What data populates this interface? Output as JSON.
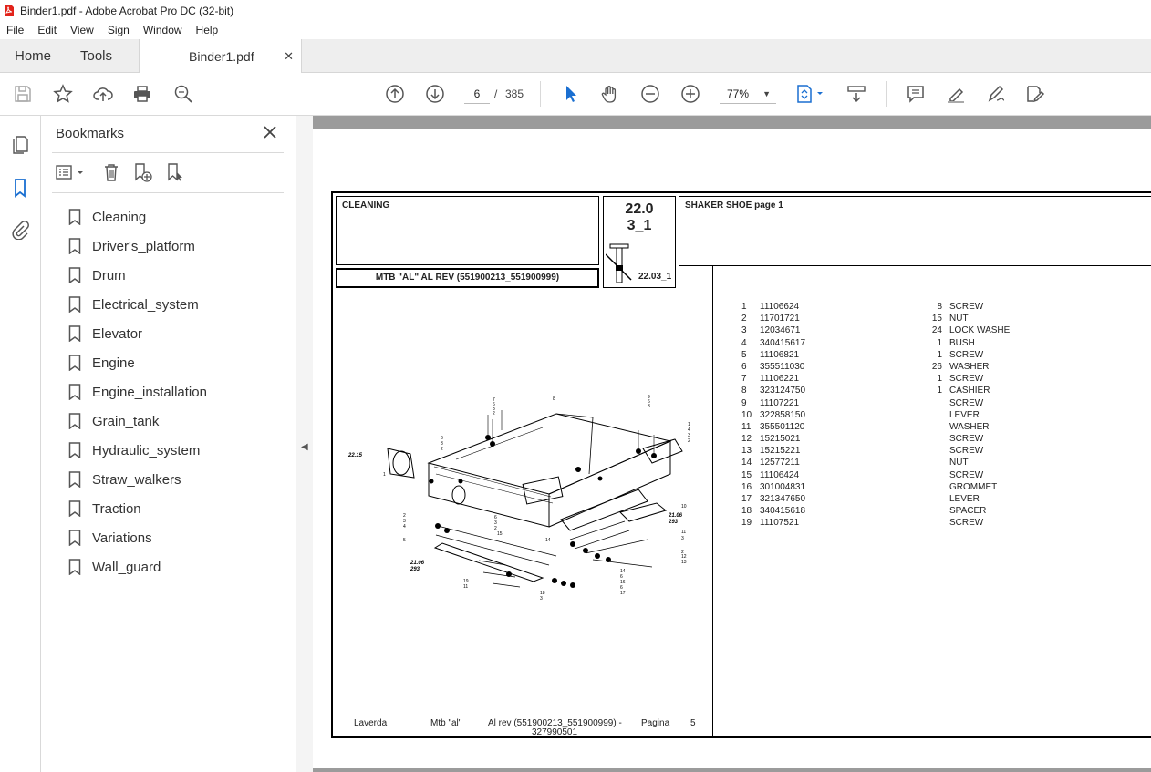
{
  "window": {
    "title": "Binder1.pdf - Adobe Acrobat Pro DC (32-bit)"
  },
  "menu": [
    "File",
    "Edit",
    "View",
    "Sign",
    "Window",
    "Help"
  ],
  "tabs": {
    "home": "Home",
    "tools": "Tools",
    "document": "Binder1.pdf"
  },
  "toolbar": {
    "current_page": "6",
    "page_separator": "/",
    "total_pages": "385",
    "zoom": "77%"
  },
  "bookmarks": {
    "title": "Bookmarks",
    "items": [
      "Cleaning",
      "Driver's_platform",
      "Drum",
      "Electrical_system",
      "Elevator",
      "Engine",
      "Engine_installation",
      "Grain_tank",
      "Hydraulic_system",
      "Straw_walkers",
      "Traction",
      "Variations",
      "Wall_guard"
    ]
  },
  "document": {
    "group_title": "CLEANING",
    "code_line1": "22.0",
    "code_line2": "3_1",
    "code_small": "22.03_1",
    "model": "MTB \"AL\" AL REV (551900213_551900999)",
    "section_title": "SHAKER SHOE  page 1",
    "parts": [
      {
        "n": "1",
        "code": "11106624",
        "qty": "8",
        "desc": "SCREW"
      },
      {
        "n": "2",
        "code": "11701721",
        "qty": "15",
        "desc": "NUT"
      },
      {
        "n": "3",
        "code": "12034671",
        "qty": "24",
        "desc": "LOCK WASHE"
      },
      {
        "n": "4",
        "code": "340415617",
        "qty": "1",
        "desc": "BUSH"
      },
      {
        "n": "5",
        "code": "11106821",
        "qty": "1",
        "desc": "SCREW"
      },
      {
        "n": "6",
        "code": "355511030",
        "qty": "26",
        "desc": "WASHER"
      },
      {
        "n": "7",
        "code": "11106221",
        "qty": "1",
        "desc": "SCREW"
      },
      {
        "n": "8",
        "code": "323124750",
        "qty": "1",
        "desc": "CASHIER"
      },
      {
        "n": "9",
        "code": "11107221",
        "qty": "",
        "desc": "SCREW"
      },
      {
        "n": "10",
        "code": "322858150",
        "qty": "",
        "desc": "LEVER"
      },
      {
        "n": "11",
        "code": "355501120",
        "qty": "",
        "desc": "WASHER"
      },
      {
        "n": "12",
        "code": "15215021",
        "qty": "",
        "desc": "SCREW"
      },
      {
        "n": "13",
        "code": "15215221",
        "qty": "",
        "desc": "SCREW"
      },
      {
        "n": "14",
        "code": "12577211",
        "qty": "",
        "desc": "NUT"
      },
      {
        "n": "15",
        "code": "11106424",
        "qty": "",
        "desc": "SCREW"
      },
      {
        "n": "16",
        "code": "301004831",
        "qty": "",
        "desc": "GROMMET"
      },
      {
        "n": "17",
        "code": "321347650",
        "qty": "",
        "desc": "LEVER"
      },
      {
        "n": "18",
        "code": "340415618",
        "qty": "",
        "desc": "SPACER"
      },
      {
        "n": "19",
        "code": "11107521",
        "qty": "",
        "desc": "SCREW"
      }
    ],
    "diagram_labels": [
      "22.15",
      "21.06",
      "293",
      "21.06",
      "293"
    ],
    "footer": {
      "brand": "Laverda",
      "model": "Mtb \"al\"",
      "range_line1": "Al rev (551900213_551900999) -",
      "range_line2": "327990501",
      "page_label": "Pagina",
      "page_num": "5"
    }
  }
}
